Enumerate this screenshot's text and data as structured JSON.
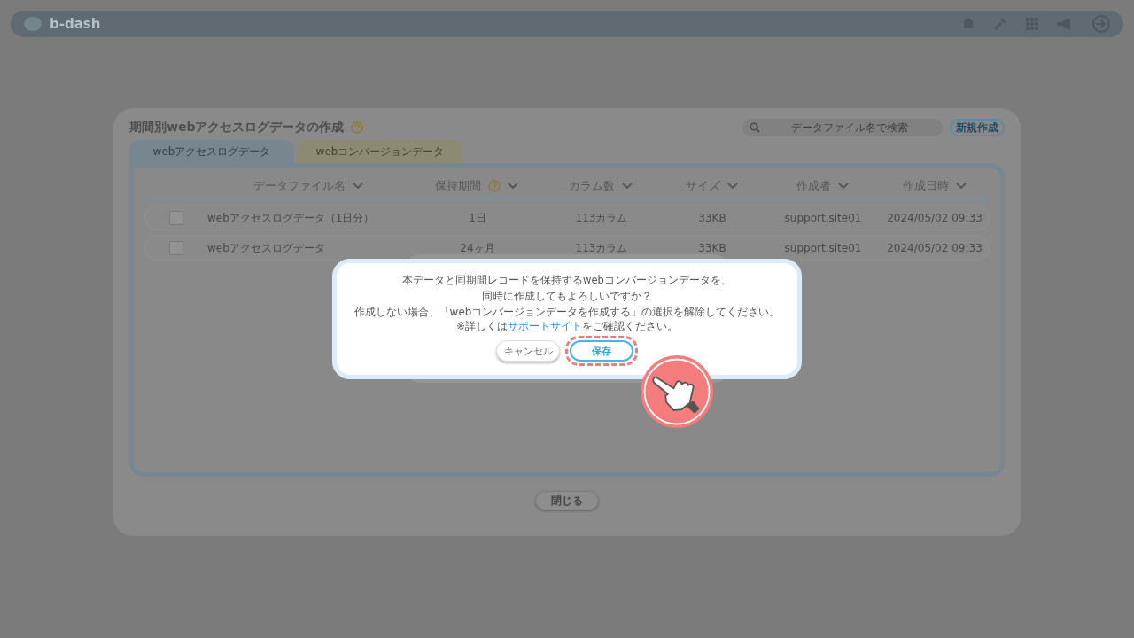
{
  "header": {
    "logo": "b-dash"
  },
  "modal": {
    "title": "期間別webアクセスログデータの作成",
    "title_help": true,
    "search": {
      "placeholder": "データファイル名で検索"
    },
    "new_button": "新規作成",
    "tabs": [
      {
        "label": "webアクセスログデータ",
        "selected": true
      },
      {
        "label": "webコンバージョンデータ",
        "selected": false
      }
    ],
    "table": {
      "columns": [
        {
          "label": "データファイル名",
          "help": false
        },
        {
          "label": "保持期間",
          "help": true
        },
        {
          "label": "カラム数",
          "help": false
        },
        {
          "label": "サイズ",
          "help": false
        },
        {
          "label": "作成者",
          "help": false
        },
        {
          "label": "作成日時",
          "help": false
        }
      ],
      "rows": [
        {
          "checked": false,
          "cells": [
            "webアクセスログデータ（1日分）",
            "1日",
            "113カラム",
            "33KB",
            "support.site01",
            "2024/05/02 09:33"
          ]
        },
        {
          "checked": false,
          "cells": [
            "webアクセスログデータ",
            "24ヶ月",
            "113カラム",
            "33KB",
            "support.site01",
            "2024/05/02 09:33"
          ]
        }
      ]
    },
    "close_button": "閉じる"
  },
  "dialog": {
    "lines": [
      "本データと同期間レコードを保持するwebコンバージョンデータを、",
      "同時に作成してもよろしいですか？"
    ],
    "instruction": "作成しない場合、「webコンバージョンデータを作成する」の選択を解除してください。",
    "note_before": "※詳しくは",
    "note_link": "サポートサイト",
    "note_after": "をご確認ください。",
    "buttons": [
      {
        "label": "キャンセル",
        "kind": "cancel",
        "highlighted": false
      },
      {
        "label": "保存",
        "kind": "primary",
        "highlighted": true
      }
    ]
  }
}
